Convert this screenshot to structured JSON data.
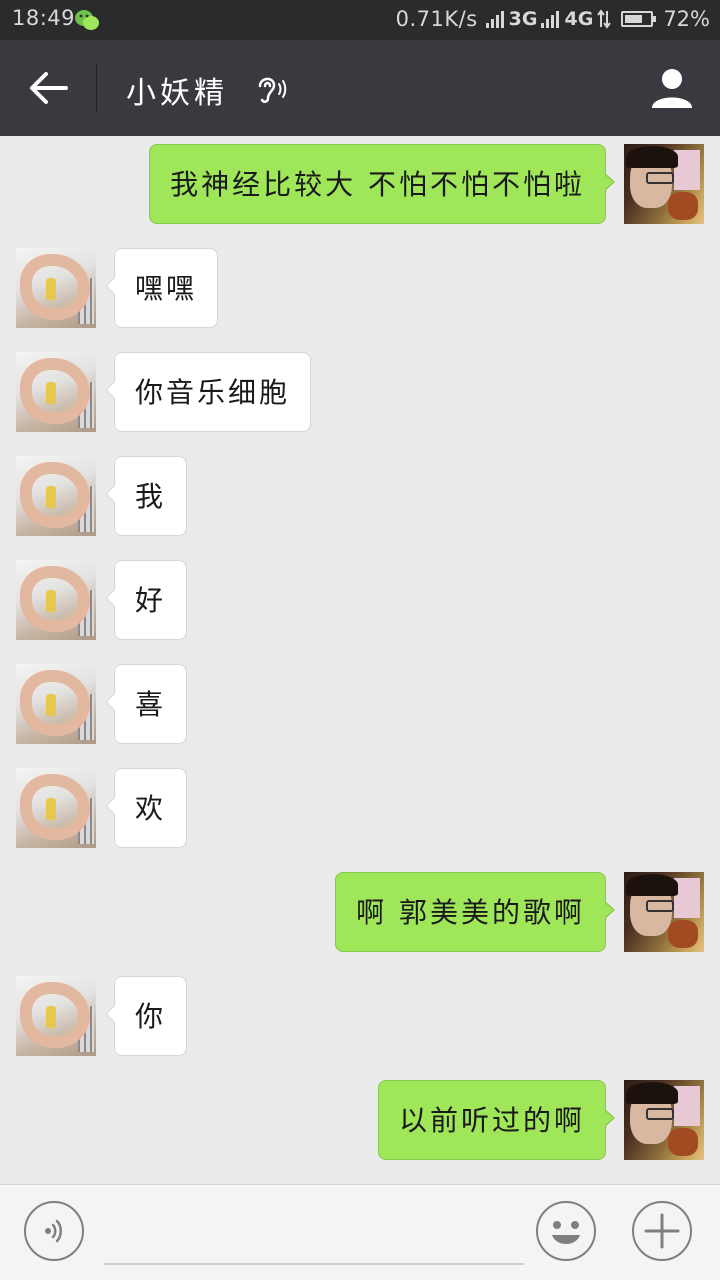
{
  "status_bar": {
    "time": "18:49",
    "app_icon": "wechat-icon",
    "net_speed": "0.71K/s",
    "network_1": "3G",
    "network_2": "4G",
    "battery_level": 0.72,
    "battery_text": "72%"
  },
  "header": {
    "back_icon": "arrow-left-icon",
    "title": "小妖精",
    "mode_icon": "ear-icon",
    "profile_icon": "person-icon",
    "colors": {
      "bar": "#393a3f",
      "text": "#ffffff"
    }
  },
  "messages": [
    {
      "side": "out",
      "text": "我神经比较大  不怕不怕不怕啦"
    },
    {
      "side": "in",
      "text": "嘿嘿"
    },
    {
      "side": "in",
      "text": "你音乐细胞"
    },
    {
      "side": "in",
      "text": "我"
    },
    {
      "side": "in",
      "text": "好"
    },
    {
      "side": "in",
      "text": "喜"
    },
    {
      "side": "in",
      "text": "欢"
    },
    {
      "side": "out",
      "text": "啊  郭美美的歌啊"
    },
    {
      "side": "in",
      "text": "你"
    },
    {
      "side": "out",
      "text": "以前听过的啊"
    }
  ],
  "input_bar": {
    "voice_icon": "voice-icon",
    "input_value": "",
    "emoji_icon": "smiley-icon",
    "more_icon": "plus-icon"
  },
  "colors": {
    "outgoing_bubble": "#9fe658",
    "incoming_bubble": "#ffffff",
    "chat_background": "#ebebeb"
  }
}
